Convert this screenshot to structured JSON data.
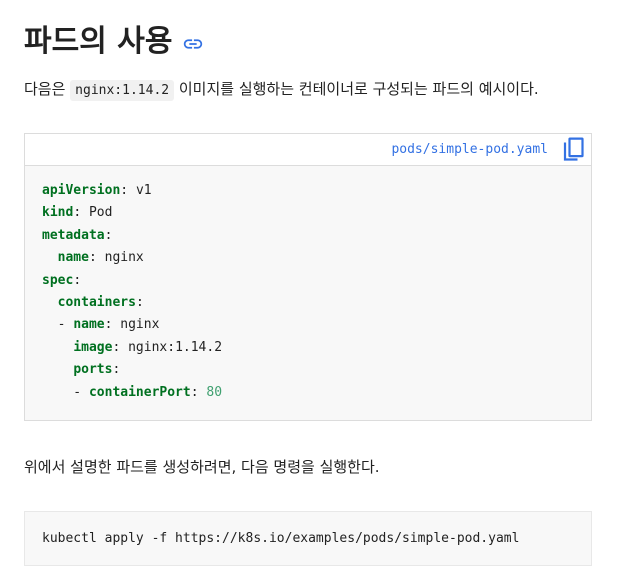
{
  "section": {
    "title": "파드의 사용",
    "anchor_icon": "link-icon"
  },
  "intro": {
    "before": "다음은 ",
    "code": "nginx:1.14.2",
    "after": " 이미지를 실행하는 컨테이너로 구성되는 파드의 예시이다."
  },
  "code_file": {
    "filename": "pods/simple-pod.yaml",
    "copy_icon": "copy-icon",
    "lines": [
      {
        "indent": "",
        "key": "apiVersion",
        "sep": ": ",
        "value": "v1"
      },
      {
        "indent": "",
        "key": "kind",
        "sep": ": ",
        "value": "Pod"
      },
      {
        "indent": "",
        "key": "metadata",
        "sep": ":",
        "value": ""
      },
      {
        "indent": "  ",
        "key": "name",
        "sep": ": ",
        "value": "nginx"
      },
      {
        "indent": "",
        "key": "spec",
        "sep": ":",
        "value": ""
      },
      {
        "indent": "  ",
        "key": "containers",
        "sep": ":",
        "value": ""
      },
      {
        "indent": "  - ",
        "key": "name",
        "sep": ": ",
        "value": "nginx"
      },
      {
        "indent": "    ",
        "key": "image",
        "sep": ": ",
        "value": "nginx:1.14.2"
      },
      {
        "indent": "    ",
        "key": "ports",
        "sep": ":",
        "value": ""
      },
      {
        "indent": "    - ",
        "key": "containerPort",
        "sep": ": ",
        "value": "80",
        "numeric": true
      }
    ]
  },
  "command_intro": "위에서 설명한 파드를 생성하려면, 다음 명령을 실행한다.",
  "command": "kubectl apply -f https://k8s.io/examples/pods/simple-pod.yaml",
  "colors": {
    "link": "#3371e3",
    "yaml_key": "#007020",
    "number": "#40a070",
    "code_background": "#f8f8f8"
  }
}
